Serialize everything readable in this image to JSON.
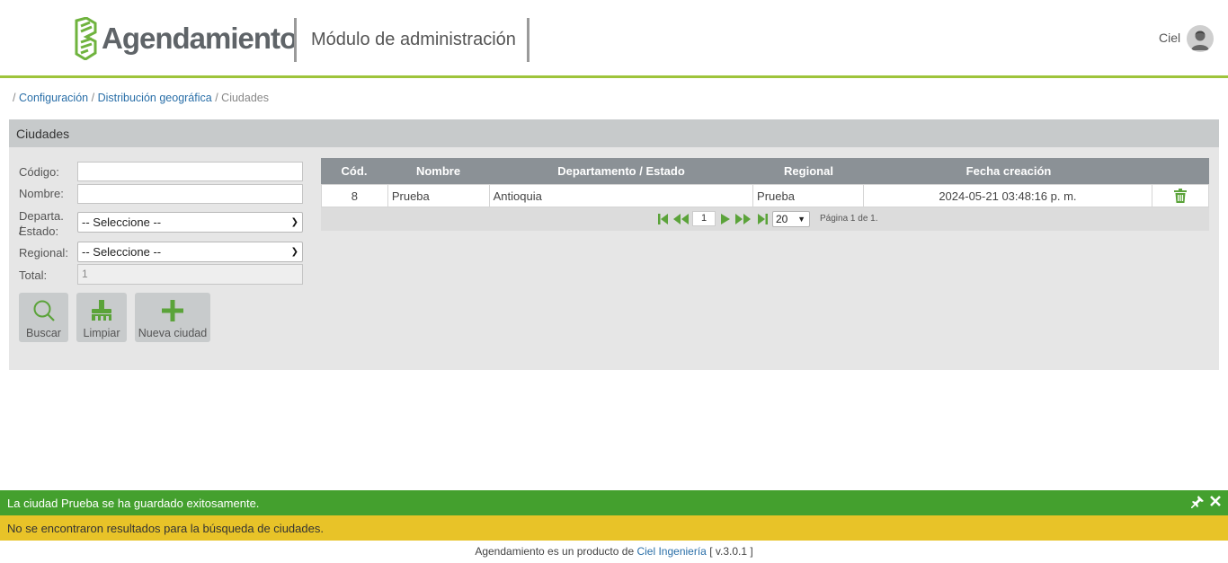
{
  "header": {
    "logo_text": "Agendamiento",
    "module_title": "Módulo de administración",
    "user_name": "Ciel"
  },
  "breadcrumb": {
    "sep": "/",
    "item1": "Configuración",
    "item2": "Distribución geográfica",
    "item3": "Ciudades"
  },
  "panel": {
    "title": "Ciudades",
    "form": {
      "codigo_label": "Código:",
      "codigo_value": "",
      "nombre_label": "Nombre:",
      "nombre_value": "",
      "departamento_label_line1": "Departa. /",
      "departamento_label_line2": "Estado:",
      "departamento_value": "-- Seleccione --",
      "regional_label": "Regional:",
      "regional_value": "-- Seleccione --",
      "total_label": "Total:",
      "total_value": "1"
    },
    "buttons": {
      "search": "Buscar",
      "clear": "Limpiar",
      "new": "Nueva ciudad"
    }
  },
  "table": {
    "columns": [
      "Cód.",
      "Nombre",
      "Departamento / Estado",
      "Regional",
      "Fecha creación",
      ""
    ],
    "rows": [
      {
        "cod": "8",
        "nombre": "Prueba",
        "departamento": "Antioquia",
        "regional": "Prueba",
        "fecha": "2024-05-21 03:48:16 p. m."
      }
    ],
    "pager": {
      "page": "1",
      "page_size": "20",
      "page_info": "Página 1 de 1."
    }
  },
  "notifications": {
    "success": "La ciudad Prueba se ha guardado exitosamente.",
    "warning": "No se encontraron resultados para la búsqueda de ciudades."
  },
  "footer": {
    "text": "Agendamiento es un producto de",
    "link": "Ciel Ingeniería",
    "version": "[ v.3.0.1 ]"
  },
  "colors": {
    "brand_green": "#5ba33a",
    "accent_line": "#9ec43b",
    "success": "#44a02e",
    "warning": "#e8c328",
    "link": "#2a6fa8"
  }
}
